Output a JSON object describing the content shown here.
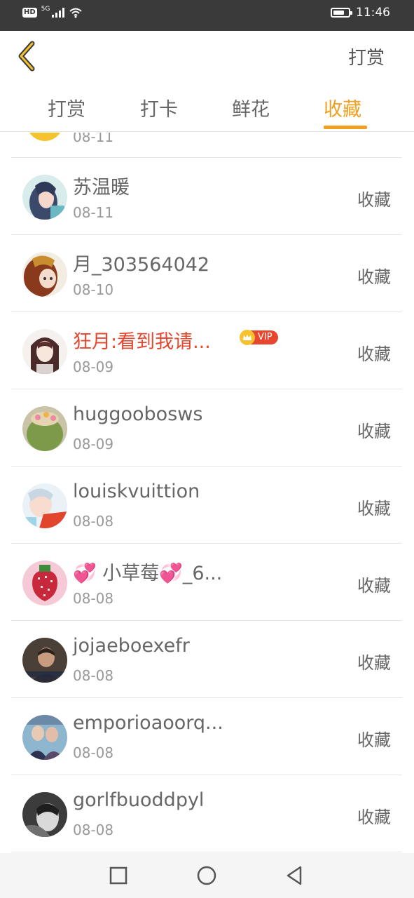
{
  "status_bar": {
    "hd": "HD",
    "network": "5G",
    "battery_level": 0.75,
    "time": "11:46"
  },
  "header": {
    "back_icon": "chevron-left-icon",
    "action_label": "打赏"
  },
  "tabs": [
    {
      "label": "打赏",
      "active": false
    },
    {
      "label": "打卡",
      "active": false
    },
    {
      "label": "鲜花",
      "active": false
    },
    {
      "label": "收藏",
      "active": true
    }
  ],
  "partial_row": {
    "date": "08-11"
  },
  "rows": [
    {
      "name": "苏温暖",
      "date": "08-11",
      "type": "收藏",
      "vip": false
    },
    {
      "name": "月_303564042",
      "date": "08-10",
      "type": "收藏",
      "vip": false
    },
    {
      "name": "狂月:看到我请...",
      "date": "08-09",
      "type": "收藏",
      "vip": true,
      "vip_label": "VIP"
    },
    {
      "name": "huggoobosws",
      "date": "08-09",
      "type": "收藏",
      "vip": false
    },
    {
      "name": "louiskvuittion",
      "date": "08-08",
      "type": "收藏",
      "vip": false
    },
    {
      "name": "💞 小草莓💞_6...",
      "date": "08-08",
      "type": "收藏",
      "vip": false
    },
    {
      "name": "jojaeboexefr",
      "date": "08-08",
      "type": "收藏",
      "vip": false
    },
    {
      "name": "emporioaoorq...",
      "date": "08-08",
      "type": "收藏",
      "vip": false
    },
    {
      "name": "gorlfbuoddpyl",
      "date": "08-08",
      "type": "收藏",
      "vip": false
    }
  ],
  "nav_bar": {
    "recent_icon": "square-icon",
    "home_icon": "circle-icon",
    "back_icon": "triangle-back-icon"
  },
  "colors": {
    "accent": "#f0a020",
    "vip_name": "#e8472f",
    "status_bar": "#3a3a3a"
  }
}
